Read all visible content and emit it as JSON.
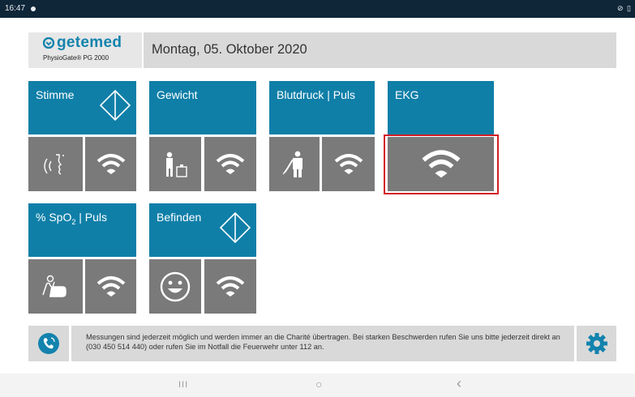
{
  "status_bar": {
    "time": "16:47",
    "icons": "⊘ ▯"
  },
  "header": {
    "brand": "getemed",
    "product": "PhysioGate® PG 2000",
    "date": "Montag, 05. Oktober 2020"
  },
  "tiles": {
    "stimme": {
      "label": "Stimme",
      "highlighted": false
    },
    "gewicht": {
      "label": "Gewicht",
      "highlighted": false
    },
    "blutdruck": {
      "label": "Blutdruck | Puls",
      "highlighted": false
    },
    "ekg": {
      "label": "EKG",
      "highlighted": true
    },
    "spo2": {
      "label_prefix": "% SpO",
      "label_sub": "2",
      "label_suffix": " | Puls",
      "highlighted": false
    },
    "befinden": {
      "label": "Befinden",
      "highlighted": false
    }
  },
  "info": {
    "message": "Messungen sind jederzeit möglich und werden immer an die Charité übertragen. Bei starken Beschwerden rufen Sie uns bitte jederzeit direkt an (030 450 514 440) oder rufen Sie im Notfall die Feuerwehr unter 112 an."
  },
  "nav": {
    "recents": "III",
    "home": "○",
    "back": "‹"
  },
  "colors": {
    "tile_blue": "#0f7fa8",
    "cell_grey": "#7a7a7a",
    "panel_grey": "#d9d9d9",
    "highlight_red": "#d21f26",
    "status_bar": "#0f2639"
  }
}
